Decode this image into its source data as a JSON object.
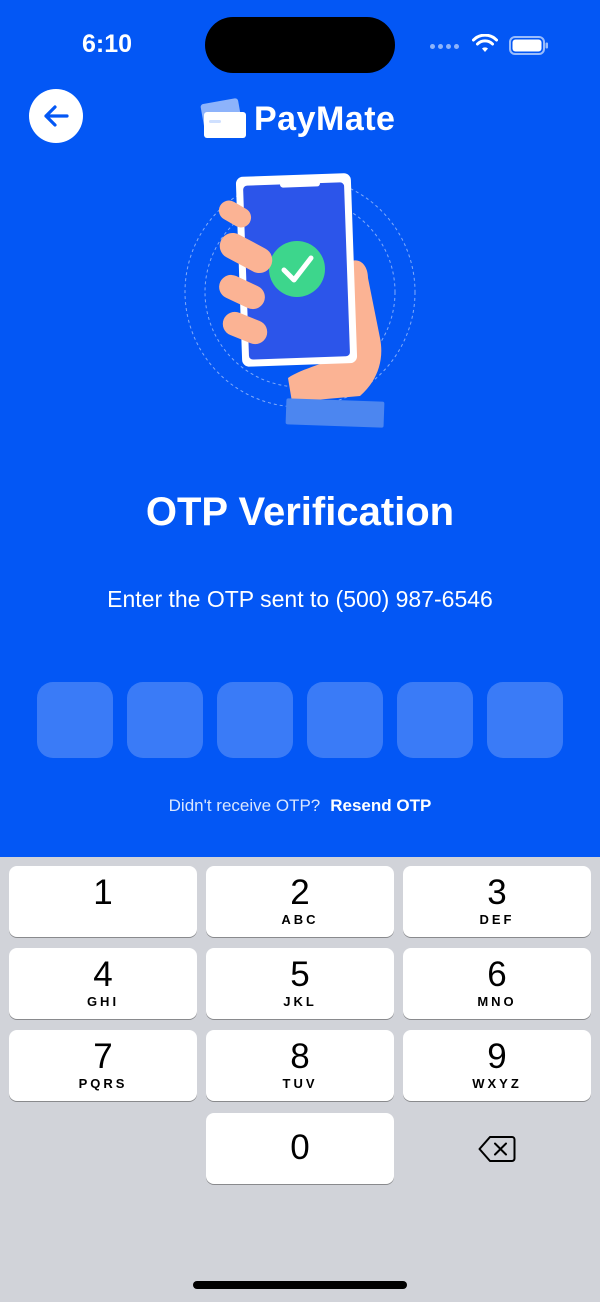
{
  "status_bar": {
    "time": "6:10"
  },
  "header": {
    "brand_name": "PayMate"
  },
  "main": {
    "title": "OTP Verification",
    "subtitle": "Enter the OTP sent to (500) 987-6546",
    "otp_digits": [
      "",
      "",
      "",
      "",
      "",
      ""
    ],
    "resend_prompt": "Didn't receive OTP?",
    "resend_label": "Resend OTP"
  },
  "keyboard": {
    "keys": [
      {
        "num": "1",
        "letters": ""
      },
      {
        "num": "2",
        "letters": "ABC"
      },
      {
        "num": "3",
        "letters": "DEF"
      },
      {
        "num": "4",
        "letters": "GHI"
      },
      {
        "num": "5",
        "letters": "JKL"
      },
      {
        "num": "6",
        "letters": "MNO"
      },
      {
        "num": "7",
        "letters": "PQRS"
      },
      {
        "num": "8",
        "letters": "TUV"
      },
      {
        "num": "9",
        "letters": "WXYZ"
      },
      {
        "num": "0",
        "letters": ""
      }
    ]
  },
  "colors": {
    "background": "#0357F5",
    "keyboard": "#D1D3D9",
    "check_green": "#3DD68C"
  },
  "icons": [
    "back-arrow-icon",
    "wallet-cards-icon",
    "phone-check-illustration",
    "wifi-icon",
    "battery-icon",
    "delete-backspace-icon"
  ]
}
